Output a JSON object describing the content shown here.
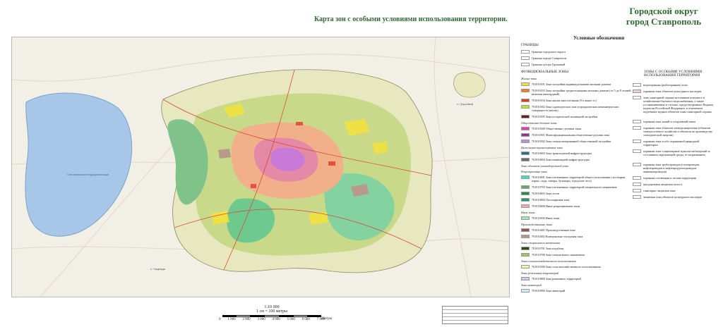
{
  "header": {
    "map_title": "Карта зон с особыми условиями использования территории.",
    "brand_line1": "Городской округ",
    "brand_line2": "город Ставрополь"
  },
  "map": {
    "lake_label": "Сенгилеевское водохранилище",
    "small_labels": [
      "с. Надежда",
      "х. Грушовый"
    ]
  },
  "scale": {
    "ratio": "1:10 000",
    "unit_line": "1 см = 100 метры",
    "ticks": [
      "0",
      "1 000",
      "2 000",
      "3 000",
      "4 000",
      "5 000",
      "6 000",
      "7 000"
    ],
    "label": "Метры"
  },
  "legend": {
    "title": "Условные обозначения",
    "boundaries_head": "ГРАНИЦЫ",
    "boundaries": [
      {
        "label": "Граница городского округа",
        "color": "#ffffff"
      },
      {
        "label": "Граница города Ставрополь",
        "color": "#ffffff"
      },
      {
        "label": "Граница хутора Грушовый",
        "color": "#ffffff"
      }
    ],
    "functional_head": "ФУНКЦИОНАЛЬНЫЕ ЗОНЫ",
    "left_items": [
      {
        "sub": "Жилые зоны"
      },
      {
        "label": "701010101 Зона застройки индивидуальными жилыми домами",
        "color": "#f5e23a"
      },
      {
        "label": "701010103 Зона застройки среднеэтажными жилыми домами (от 5 до 8 этажей, включая мансардный)",
        "color": "#f07a22"
      },
      {
        "label": "701010104 Зона жилая многоэтажная (9 и выше эт.)",
        "color": "#e23b2e"
      },
      {
        "label": "701010302 Зона садоводческих или огороднических некоммерческих товариществ (жилая)",
        "color": "#b7e03a"
      },
      {
        "label": "701010505 Зона исторической жилищной застройки",
        "color": "#6b1d1d"
      },
      {
        "sub": "Общественно-деловые зоны"
      },
      {
        "label": "701010500 Общественно-деловые зоны",
        "color": "#e23fb1"
      },
      {
        "label": "701010501 Многофункциональная общественно-деловая зона",
        "color": "#9c2f9c"
      },
      {
        "label": "701010502 Зона специализированной общественной застройки",
        "color": "#c48ae0"
      },
      {
        "sub": "Инженерно-транспортные зоны"
      },
      {
        "label": "701010603 Зона транспортной инфраструктуры",
        "color": "#2a6f8c"
      },
      {
        "label": "701010604 Зона инженерной инфраструктуры",
        "color": "#6b6b7a"
      },
      {
        "sub": "Зона объектов уличнодорожной сети"
      },
      {
        "sub": "Рекреационные зоны"
      },
      {
        "label": "701010601 Зона озелененных территорий общего пользования (лесопарки, парки, сады, скверы, бульвары, городские леса)",
        "color": "#3ee0c0"
      },
      {
        "label": "701010703 Зона озелененных территорий специального назначения",
        "color": "#6aa86a"
      },
      {
        "label": "701010603 Зона лесов",
        "color": "#2f8a4a"
      },
      {
        "label": "701010604 Лесопарковая зона",
        "color": "#1f9a6a"
      },
      {
        "label": "701010606 Иные рекреационные зоны",
        "color": "#f0a8a8"
      },
      {
        "sub": "Иные зоны"
      },
      {
        "label": "701011000 Иные зоны",
        "color": "#9ee8b8"
      },
      {
        "sub": "Производственные зоны"
      },
      {
        "label": "701010401 Производственная зона",
        "color": "#8a5a4a"
      },
      {
        "label": "701010402 Коммунально-складская зона",
        "color": "#b89a8a"
      },
      {
        "sub": "Зоны специального назначения"
      },
      {
        "label": "701010701 Зона кладбищ",
        "color": "#2e4a0a"
      },
      {
        "label": "701010700 Зона специального назначения",
        "color": "#a6c070"
      },
      {
        "sub": "Зоны сельскохозяйственного использования"
      },
      {
        "label": "701010500 Зона сельскохозяйственного использования",
        "color": "#f8f0b0"
      },
      {
        "sub": "Зоны режимных территорий"
      },
      {
        "label": "701010800 Зона режимных территорий",
        "color": "#c8c8f0"
      },
      {
        "sub": "Зона акваторий"
      },
      {
        "label": "701010900 Зона акваторий",
        "color": "#c8f0f8"
      }
    ],
    "special_head": "ЗОНЫ С ОСОБЫМИ УСЛОВИЯМИ ИСПОЛЬЗОВАНИЯ ТЕРРИТОРИИ",
    "right_items": [
      {
        "label": "водоохранная (рыбоохранная) зона",
        "color": "#ffffff"
      },
      {
        "label": "охранная зона объектов культурного наследия",
        "color": "#e8d0e0"
      },
      {
        "label": "зона санитарной охраны источников питьевого и хозяйственно-бытового водоснабжения, а также устанавливаемые в случаях, предусмотренных Водным кодексом Российской Федерации, в отношении подземных водных объектов зоны санитарной охраны",
        "color": "#ffffff"
      },
      {
        "label": "охранная зона линий и сооружений связи",
        "color": "#ffffff"
      },
      {
        "label": "охранная зона объектов электроэнергетики (объектов электросетевого хозяйства и объектов по производству электрической энергии)",
        "color": "#ffffff"
      },
      {
        "label": "охранная зона особо охраняемой природной территории",
        "color": "#ffffff"
      },
      {
        "label": "охранная зона стационарных пунктов наблюдений за состоянием окружающей среды, ее загрязнением",
        "color": "#ffffff"
      },
      {
        "label": "охранная зона трубопроводов (газопроводов, нефтепроводов и нефтепродуктопроводов, аммиакопроводов)",
        "color": "#ffffff"
      },
      {
        "label": "охранная соловецкая и лесная территории",
        "color": "#ffffff"
      },
      {
        "label": "придорожная защитная полоса",
        "color": "#ffffff"
      },
      {
        "label": "санитарно-защитная зона",
        "color": "#ffffff"
      },
      {
        "label": "защитная зона объектов культурного наследия",
        "color": "#ffffff"
      }
    ]
  }
}
